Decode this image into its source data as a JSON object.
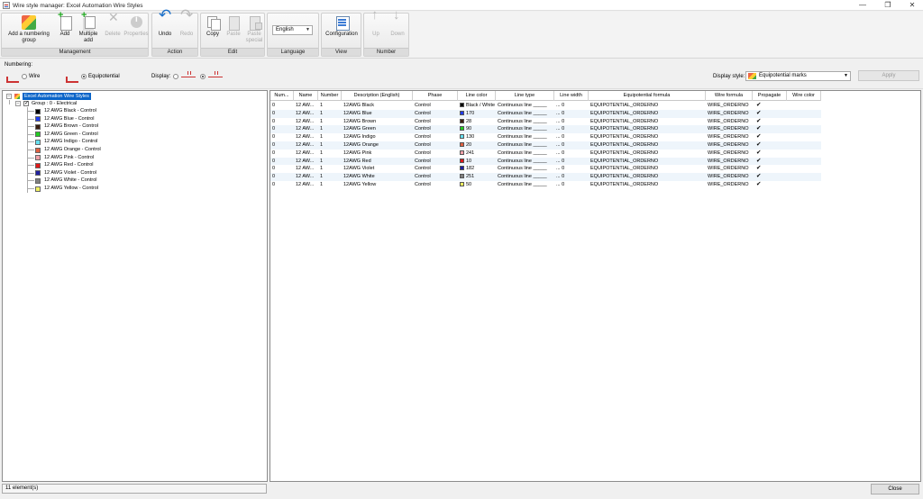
{
  "window": {
    "title": "Wire style manager: Excel Automation Wire Styles",
    "minimize": "—",
    "restore": "❐",
    "close": "✕"
  },
  "ribbon": {
    "groups": {
      "management": "Management",
      "action": "Action",
      "edit": "Edit",
      "language": "Language",
      "view": "View",
      "number": "Number"
    },
    "buttons": {
      "add_numbering_group_1": "Add a numbering",
      "add_numbering_group_2": "group",
      "add": "Add",
      "multiple_add_1": "Multiple",
      "multiple_add_2": "add",
      "delete": "Delete",
      "properties": "Properties",
      "undo": "Undo",
      "redo": "Redo",
      "copy": "Copy",
      "paste": "Paste",
      "paste_special_1": "Paste",
      "paste_special_2": "special",
      "configuration": "Configuration",
      "up": "Up",
      "down": "Down"
    },
    "language_value": "English"
  },
  "options": {
    "numbering_label": "Numbering:",
    "wire_label": "Wire",
    "equipotential_label": "Equipotential",
    "display_label": "Display:",
    "display_style_label": "Display style:",
    "display_style_value": "Equipotential marks",
    "apply": "Apply"
  },
  "tree": {
    "root": "Excel Automation Wire Styles",
    "group": "Group : 0 - Electrical",
    "items": [
      {
        "label": "12 AWG Black - Control",
        "color": "#000000"
      },
      {
        "label": "12 AWG Blue - Control",
        "color": "#1f3cf0"
      },
      {
        "label": "12 AWG Brown - Control",
        "color": "#3a1e10"
      },
      {
        "label": "12 AWG Green - Control",
        "color": "#22cc22"
      },
      {
        "label": "12 AWG Indigo - Control",
        "color": "#66e0f0"
      },
      {
        "label": "12 AWG Orange - Control",
        "color": "#e06040"
      },
      {
        "label": "12 AWG Pink - Control",
        "color": "#f0a0a8"
      },
      {
        "label": "12 AWG Red - Control",
        "color": "#e01818"
      },
      {
        "label": "12 AWG Violet - Control",
        "color": "#2020a0"
      },
      {
        "label": "12 AWG White - Control",
        "color": "#808080"
      },
      {
        "label": "12 AWG Yellow - Control",
        "color": "#f0f060"
      }
    ]
  },
  "grid": {
    "headers": [
      "Num...",
      "Name",
      "Number",
      "Description (English)",
      "Phase",
      "Line color",
      "Line type",
      "Line width",
      "Equipotential formula",
      "Wire formula",
      "Propagate",
      "Wire color"
    ],
    "rows": [
      {
        "num": "0",
        "name": "12 AW...",
        "number": "1",
        "desc": "12AWG Black",
        "phase": "Control",
        "color_val": "Black / White",
        "color": "#000000",
        "ltype": "Continuous line _____",
        "lwidth": "... 0",
        "eq": "EQUIPOTENTIAL_ORDERNO",
        "wire": "WIRE_ORDERNO",
        "prop": "✔"
      },
      {
        "num": "0",
        "name": "12 AW...",
        "number": "1",
        "desc": "12AWG Blue",
        "phase": "Control",
        "color_val": "170",
        "color": "#1f3cf0",
        "ltype": "Continuous line _____",
        "lwidth": "... 0",
        "eq": "EQUIPOTENTIAL_ORDERNO",
        "wire": "WIRE_ORDERNO",
        "prop": "✔"
      },
      {
        "num": "0",
        "name": "12 AW...",
        "number": "1",
        "desc": "12AWG Brown",
        "phase": "Control",
        "color_val": "28",
        "color": "#3a1e10",
        "ltype": "Continuous line _____",
        "lwidth": "... 0",
        "eq": "EQUIPOTENTIAL_ORDERNO",
        "wire": "WIRE_ORDERNO",
        "prop": "✔"
      },
      {
        "num": "0",
        "name": "12 AW...",
        "number": "1",
        "desc": "12AWG Green",
        "phase": "Control",
        "color_val": "90",
        "color": "#22cc22",
        "ltype": "Continuous line _____",
        "lwidth": "... 0",
        "eq": "EQUIPOTENTIAL_ORDERNO",
        "wire": "WIRE_ORDERNO",
        "prop": "✔"
      },
      {
        "num": "0",
        "name": "12 AW...",
        "number": "1",
        "desc": "12AWG Indigo",
        "phase": "Control",
        "color_val": "130",
        "color": "#66e0f0",
        "ltype": "Continuous line _____",
        "lwidth": "... 0",
        "eq": "EQUIPOTENTIAL_ORDERNO",
        "wire": "WIRE_ORDERNO",
        "prop": "✔"
      },
      {
        "num": "0",
        "name": "12 AW...",
        "number": "1",
        "desc": "12AWG Orange",
        "phase": "Control",
        "color_val": "20",
        "color": "#e06040",
        "ltype": "Continuous line _____",
        "lwidth": "... 0",
        "eq": "EQUIPOTENTIAL_ORDERNO",
        "wire": "WIRE_ORDERNO",
        "prop": "✔"
      },
      {
        "num": "0",
        "name": "12 AW...",
        "number": "1",
        "desc": "12AWG Pink",
        "phase": "Control",
        "color_val": "241",
        "color": "#f0a0a8",
        "ltype": "Continuous line _____",
        "lwidth": "... 0",
        "eq": "EQUIPOTENTIAL_ORDERNO",
        "wire": "WIRE_ORDERNO",
        "prop": "✔"
      },
      {
        "num": "0",
        "name": "12 AW...",
        "number": "1",
        "desc": "12AWG Red",
        "phase": "Control",
        "color_val": "10",
        "color": "#e01818",
        "ltype": "Continuous line _____",
        "lwidth": "... 0",
        "eq": "EQUIPOTENTIAL_ORDERNO",
        "wire": "WIRE_ORDERNO",
        "prop": "✔"
      },
      {
        "num": "0",
        "name": "12 AW...",
        "number": "1",
        "desc": "12AWG Violet",
        "phase": "Control",
        "color_val": "182",
        "color": "#2020a0",
        "ltype": "Continuous line _____",
        "lwidth": "... 0",
        "eq": "EQUIPOTENTIAL_ORDERNO",
        "wire": "WIRE_ORDERNO",
        "prop": "✔"
      },
      {
        "num": "0",
        "name": "12 AW...",
        "number": "1",
        "desc": "12AWG White",
        "phase": "Control",
        "color_val": "251",
        "color": "#808080",
        "ltype": "Continuous line _____",
        "lwidth": "... 0",
        "eq": "EQUIPOTENTIAL_ORDERNO",
        "wire": "WIRE_ORDERNO",
        "prop": "✔"
      },
      {
        "num": "0",
        "name": "12 AW...",
        "number": "1",
        "desc": "12AWG Yellow",
        "phase": "Control",
        "color_val": "50",
        "color": "#f0f060",
        "ltype": "Continuous line _____",
        "lwidth": "... 0",
        "eq": "EQUIPOTENTIAL_ORDERNO",
        "wire": "WIRE_ORDERNO",
        "prop": "✔"
      }
    ]
  },
  "status": {
    "count": "11 element(s)",
    "close": "Close"
  }
}
